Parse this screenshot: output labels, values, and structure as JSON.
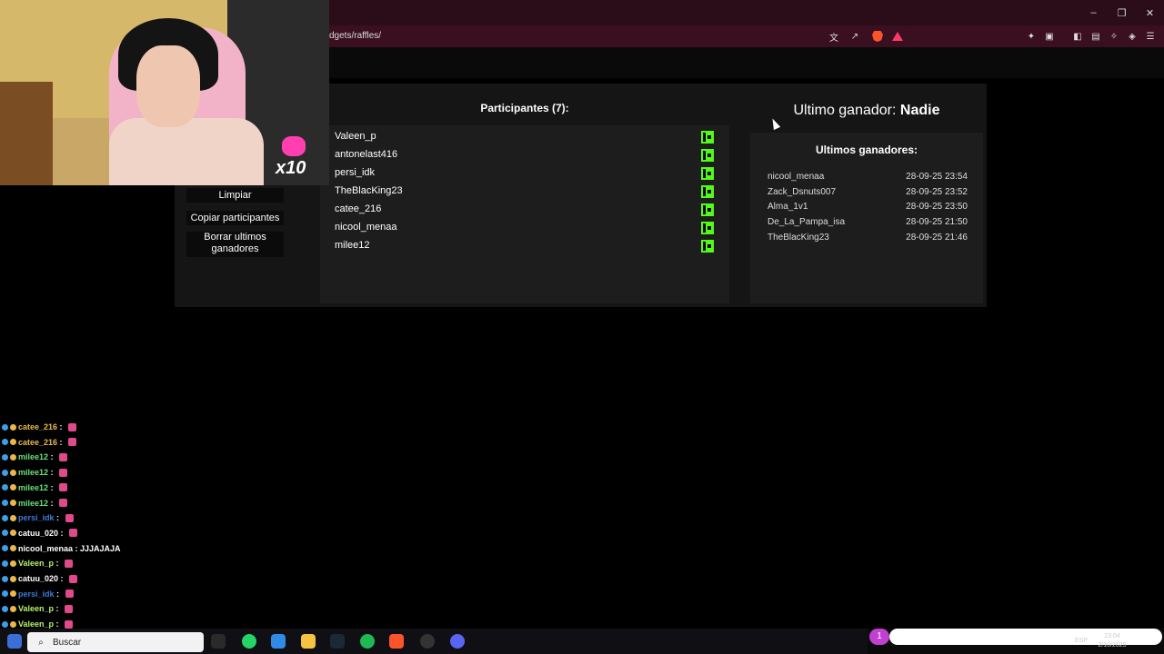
{
  "browser": {
    "url": "dgets/raffles/",
    "window_controls": [
      "–",
      "❐",
      "✕"
    ]
  },
  "side_menu": {
    "clear_label": "Limpiar",
    "copy_label": "Copiar participantes",
    "delete_label_line1": "Borrar ultimos",
    "delete_label_line2": "ganadores"
  },
  "participants": {
    "title": "Participantes (7):",
    "items": [
      {
        "name": "Valeen_p"
      },
      {
        "name": "antonelast416"
      },
      {
        "name": "persi_idk"
      },
      {
        "name": "TheBlacKing23"
      },
      {
        "name": "catee_216"
      },
      {
        "name": "nicool_menaa"
      },
      {
        "name": "milee12"
      }
    ]
  },
  "winner": {
    "label": "Ultimo ganador:",
    "name": "Nadie"
  },
  "last_winners": {
    "title": "Ultimos ganadores:",
    "items": [
      {
        "name": "nicool_menaa",
        "date": "28-09-25 23:54"
      },
      {
        "name": "Zack_Dsnuts007",
        "date": "28-09-25 23:52"
      },
      {
        "name": "Alma_1v1",
        "date": "28-09-25 23:50"
      },
      {
        "name": "De_La_Pampa_isa",
        "date": "28-09-25 21:50"
      },
      {
        "name": "TheBlacKing23",
        "date": "28-09-25 21:46"
      }
    ]
  },
  "overlay": {
    "multiplier": "x10"
  },
  "chat": {
    "lines": [
      {
        "user": "catee_216",
        "message": "",
        "color": "#e8b84a"
      },
      {
        "user": "catee_216",
        "message": "",
        "color": "#e8b84a"
      },
      {
        "user": "milee12",
        "message": "",
        "color": "#6de07a"
      },
      {
        "user": "milee12",
        "message": "",
        "color": "#6de07a"
      },
      {
        "user": "milee12",
        "message": "",
        "color": "#6de07a"
      },
      {
        "user": "milee12",
        "message": "",
        "color": "#6de07a"
      },
      {
        "user": "persi_idk",
        "message": "",
        "color": "#3b7bd6"
      },
      {
        "user": "catuu_020",
        "message": "",
        "color": "#ffffff"
      },
      {
        "user": "nicool_menaa",
        "message": "JJJAJAJA",
        "color": "#ffffff"
      },
      {
        "user": "Valeen_p",
        "message": "",
        "color": "#b6f06a"
      },
      {
        "user": "catuu_020",
        "message": "",
        "color": "#ffffff"
      },
      {
        "user": "persi_idk",
        "message": "",
        "color": "#3b7bd6"
      },
      {
        "user": "Valeen_p",
        "message": "",
        "color": "#b6f06a"
      },
      {
        "user": "Valeen_p",
        "message": "",
        "color": "#b6f06a"
      }
    ]
  },
  "taskbar": {
    "search_placeholder": "Buscar",
    "language": "ESP",
    "time": "23:04",
    "date": "2/10/2025",
    "notification_count": "1"
  },
  "colors": {
    "kick_green": "#53fc18",
    "titlebar": "#2a0d18",
    "panel": "#151515"
  }
}
